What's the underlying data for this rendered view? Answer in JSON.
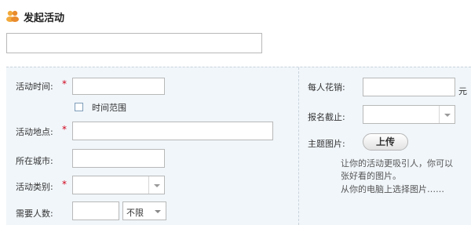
{
  "header": {
    "title": "发起活动",
    "icon": "people-icon"
  },
  "title_input": {
    "value": ""
  },
  "left": {
    "time_label": "活动时间:",
    "time_range_label": "时间范围",
    "location_label": "活动地点:",
    "city_label": "所在城市:",
    "category_label": "活动类别:",
    "people_label": "需要人数:",
    "people_limit_selected": "不限"
  },
  "right": {
    "cost_label": "每人花销:",
    "cost_unit": "元",
    "deadline_label": "报名截止:",
    "image_label": "主题图片:",
    "upload_button": "上传",
    "hint_line1": "让你的活动更吸引人，你可以",
    "hint_line2": "张好看的图片。",
    "hint_line3": "从你的电脑上选择图片‥‥‥"
  },
  "required_mark": "*",
  "colors": {
    "required": "#d0021b",
    "panel_bg": "#f1f6fa",
    "border": "#b8b8b8"
  }
}
